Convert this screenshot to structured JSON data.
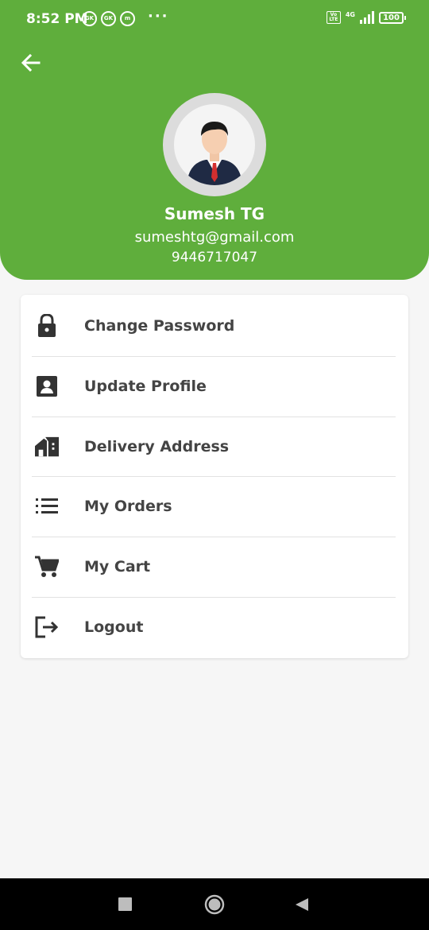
{
  "status_bar": {
    "time": "8:52 PM",
    "app_icons": [
      "GK",
      "GK",
      "m"
    ],
    "more": "···",
    "network": "4G",
    "volte": "Vo LTE",
    "battery": "100"
  },
  "header": {
    "background_color": "#5fae3c",
    "back_icon": "arrow-left-icon"
  },
  "profile": {
    "name": "Sumesh TG",
    "email": "sumeshtg@gmail.com",
    "phone": "9446717047"
  },
  "menu": {
    "items": [
      {
        "label": "Change Password",
        "icon": "lock-icon"
      },
      {
        "label": "Update Profile",
        "icon": "account-box-icon"
      },
      {
        "label": "Delivery Address",
        "icon": "home-address-icon"
      },
      {
        "label": "My Orders",
        "icon": "list-icon"
      },
      {
        "label": "My Cart",
        "icon": "cart-icon"
      },
      {
        "label": "Logout",
        "icon": "logout-icon"
      }
    ]
  },
  "nav_bar": {
    "buttons": [
      "recents",
      "home",
      "back"
    ]
  }
}
